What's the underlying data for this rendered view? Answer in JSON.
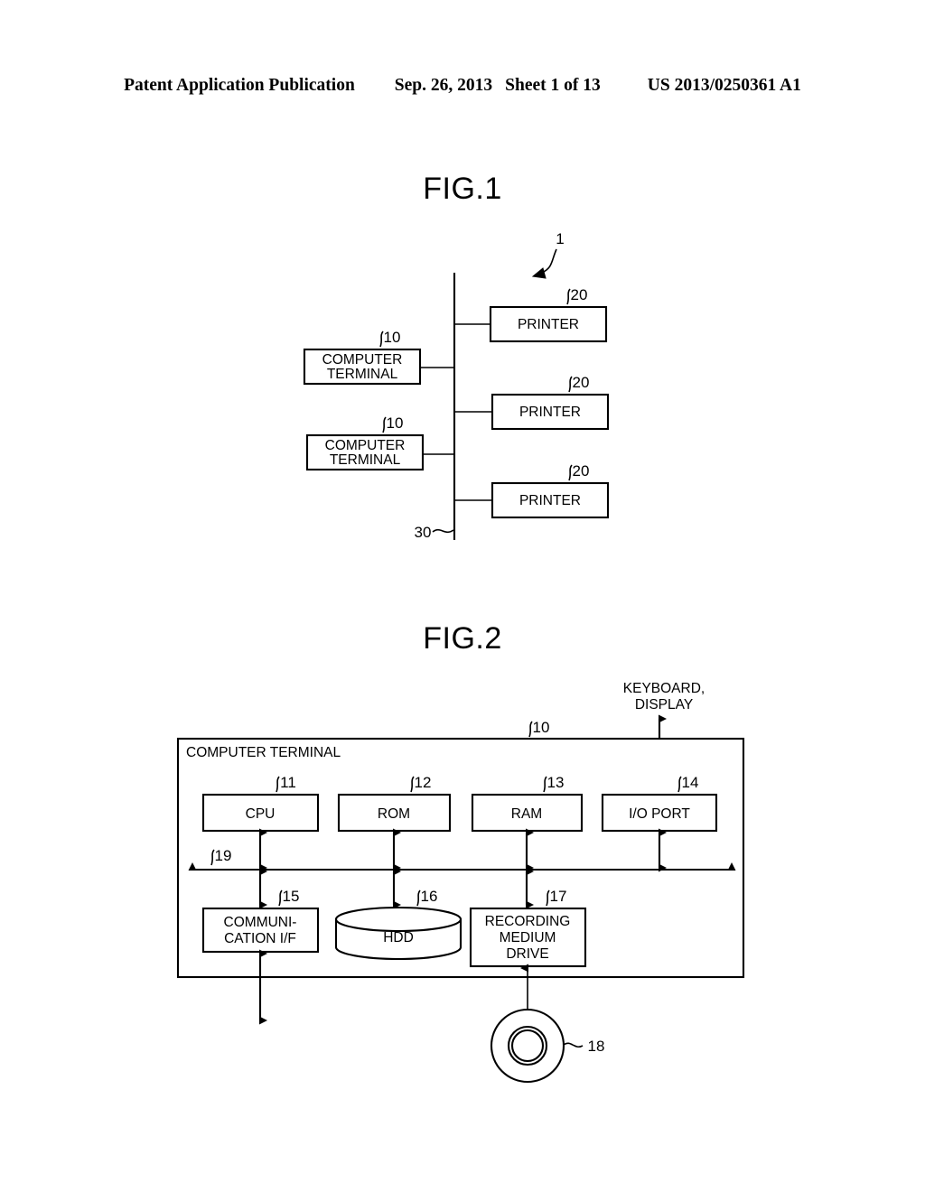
{
  "header": {
    "publication": "Patent Application Publication",
    "date": "Sep. 26, 2013",
    "sheet": "Sheet 1 of 13",
    "patent_number": "US 2013/0250361 A1"
  },
  "figures": [
    {
      "id": "fig1",
      "title": "FIG.1",
      "system_ref": "1",
      "network_ref": "30",
      "nodes": [
        {
          "label": "COMPUTER\nTERMINAL",
          "line1": "COMPUTER",
          "line2": "TERMINAL",
          "ref": "10"
        },
        {
          "label": "COMPUTER\nTERMINAL",
          "line1": "COMPUTER",
          "line2": "TERMINAL",
          "ref": "10"
        },
        {
          "label": "PRINTER",
          "line1": "PRINTER",
          "line2": "",
          "ref": "20"
        },
        {
          "label": "PRINTER",
          "line1": "PRINTER",
          "line2": "",
          "ref": "20"
        },
        {
          "label": "PRINTER",
          "line1": "PRINTER",
          "line2": "",
          "ref": "20"
        }
      ]
    },
    {
      "id": "fig2",
      "title": "FIG.2",
      "enclosure_label": "COMPUTER TERMINAL",
      "enclosure_ref": "10",
      "external_label_line1": "KEYBOARD,",
      "external_label_line2": "DISPLAY",
      "bus_ref": "19",
      "blocks": [
        {
          "label": "CPU",
          "line1": "CPU",
          "line2": "",
          "line3": "",
          "ref": "11"
        },
        {
          "label": "ROM",
          "line1": "ROM",
          "line2": "",
          "line3": "",
          "ref": "12"
        },
        {
          "label": "RAM",
          "line1": "RAM",
          "line2": "",
          "line3": "",
          "ref": "13"
        },
        {
          "label": "I/O PORT",
          "line1": "I/O PORT",
          "line2": "",
          "line3": "",
          "ref": "14"
        },
        {
          "label": "COMMUNI-CATION I/F",
          "line1": "COMMUNI-",
          "line2": "CATION I/F",
          "line3": "",
          "ref": "15"
        },
        {
          "label": "HDD",
          "line1": "HDD",
          "line2": "",
          "line3": "",
          "ref": "16"
        },
        {
          "label": "RECORDING MEDIUM DRIVE",
          "line1": "RECORDING",
          "line2": "MEDIUM",
          "line3": "DRIVE",
          "ref": "17"
        },
        {
          "label": "recording medium disc",
          "line1": "",
          "line2": "",
          "line3": "",
          "ref": "18"
        }
      ]
    }
  ],
  "colors": {
    "ink": "#000000",
    "paper": "#ffffff"
  }
}
